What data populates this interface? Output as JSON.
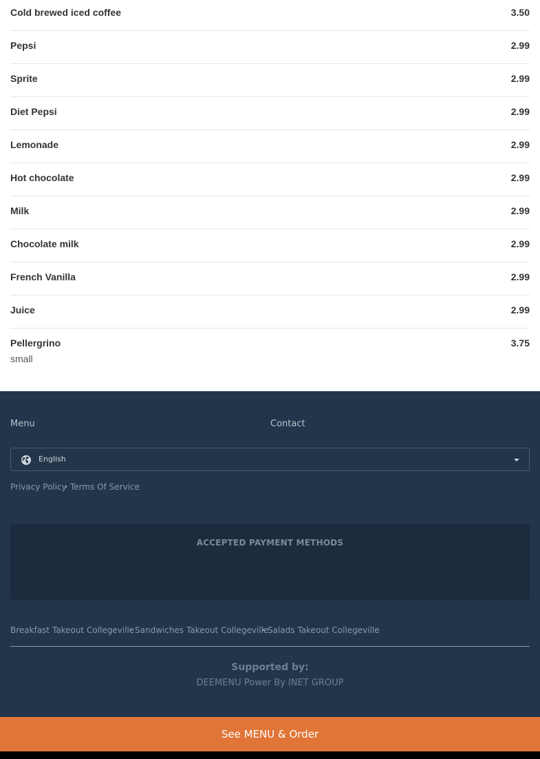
{
  "menu": {
    "items": [
      {
        "name": "Cold brewed iced coffee",
        "price": "3.50"
      },
      {
        "name": "Pepsi",
        "price": "2.99"
      },
      {
        "name": "Sprite",
        "price": "2.99"
      },
      {
        "name": "Diet Pepsi",
        "price": "2.99"
      },
      {
        "name": "Lemonade",
        "price": "2.99"
      },
      {
        "name": "Hot chocolate",
        "price": "2.99"
      },
      {
        "name": "Milk",
        "price": "2.99"
      },
      {
        "name": "Chocolate milk",
        "price": "2.99"
      },
      {
        "name": "French Vanilla",
        "price": "2.99"
      },
      {
        "name": "Juice",
        "price": "2.99"
      },
      {
        "name": "Pellergrino",
        "price": "3.75",
        "description": "small"
      }
    ]
  },
  "footer": {
    "nav": {
      "menu_label": "Menu",
      "contact_label": "Contact"
    },
    "language": {
      "selected": "English",
      "icon": "globe-icon"
    },
    "legal": {
      "privacy_label": "Privacy Policy",
      "terms_label": "Terms Of Service",
      "separator": "•"
    },
    "payment": {
      "title": "ACCEPTED PAYMENT METHODS"
    },
    "categories": {
      "items": [
        "Breakfast Takeout Collegeville",
        "Sandwiches Takeout Collegeville",
        "Salads Takeout Collegeville"
      ],
      "separator": "•"
    },
    "supported": {
      "title": "Supported by:",
      "text": "DEEMENU Power By INET GROUP"
    }
  },
  "cta": {
    "label": "See MENU & Order"
  },
  "colors": {
    "footer_bg": "#22354a",
    "payment_bg": "#1c2c3e",
    "cta_bg": "#e07537",
    "text_dark": "#333333"
  }
}
